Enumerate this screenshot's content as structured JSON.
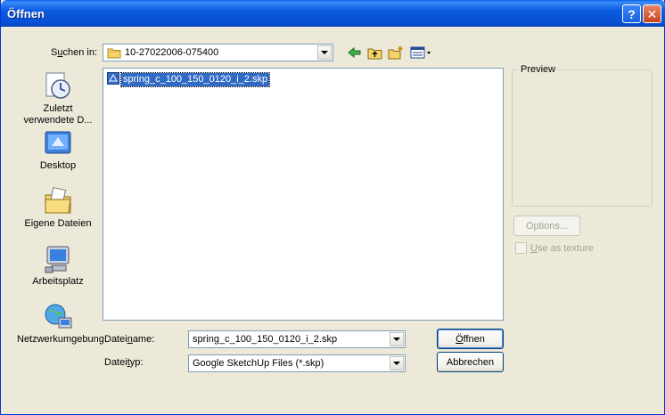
{
  "window": {
    "title": "Öffnen",
    "help_label": "?",
    "close_label": "✕"
  },
  "lookin": {
    "label_pre": "S",
    "label_ul": "u",
    "label_post": "chen in:",
    "value": "10-27022006-075400"
  },
  "toolbar": {
    "icons": [
      "back-arrow-icon",
      "up-folder-icon",
      "new-folder-icon",
      "view-menu-icon"
    ]
  },
  "places": [
    {
      "label": "Zuletzt verwendete D...",
      "icon": "recent-documents-icon"
    },
    {
      "label": "Desktop",
      "icon": "desktop-icon"
    },
    {
      "label": "Eigene Dateien",
      "icon": "my-documents-icon"
    },
    {
      "label": "Arbeitsplatz",
      "icon": "my-computer-icon"
    },
    {
      "label": "Netzwerkumgebung",
      "icon": "network-places-icon"
    }
  ],
  "files": [
    {
      "name": "spring_c_100_150_0120_i_2.skp",
      "icon": "sketchup-file-icon",
      "selected": true
    }
  ],
  "filename": {
    "label_pre": "Datei",
    "label_ul": "n",
    "label_post": "ame:",
    "value": "spring_c_100_150_0120_i_2.skp"
  },
  "filetype": {
    "label_pre": "Datei",
    "label_ul": "t",
    "label_post": "yp:",
    "value": "Google SketchUp Files (*.skp)"
  },
  "buttons": {
    "open_pre": "",
    "open_ul": "Ö",
    "open_post": "ffnen",
    "cancel": "Abbrechen",
    "options": "Options..."
  },
  "preview": {
    "label": "Preview",
    "use_texture_ul": "U",
    "use_texture_post": "se as texture"
  },
  "colors": {
    "titlebar": "#0a5fe8",
    "selection": "#316ac5",
    "dialog_bg": "#ece9d8"
  }
}
